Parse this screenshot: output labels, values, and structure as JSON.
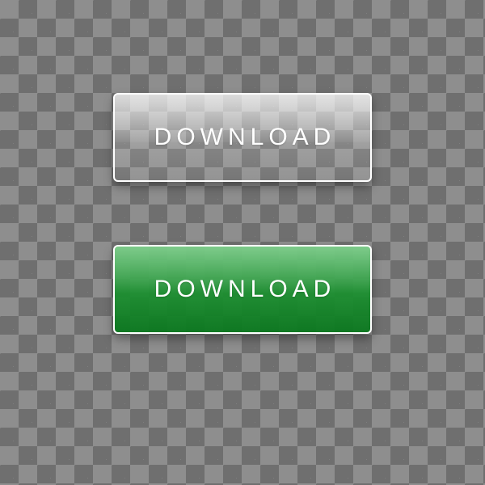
{
  "buttons": {
    "glass": {
      "label": "DOWNLOAD"
    },
    "green": {
      "label": "DOWNLOAD"
    }
  },
  "colors": {
    "green_start": "#3cb450",
    "green_end": "#0a781e",
    "border": "#ffffff",
    "text": "#ffffff"
  }
}
